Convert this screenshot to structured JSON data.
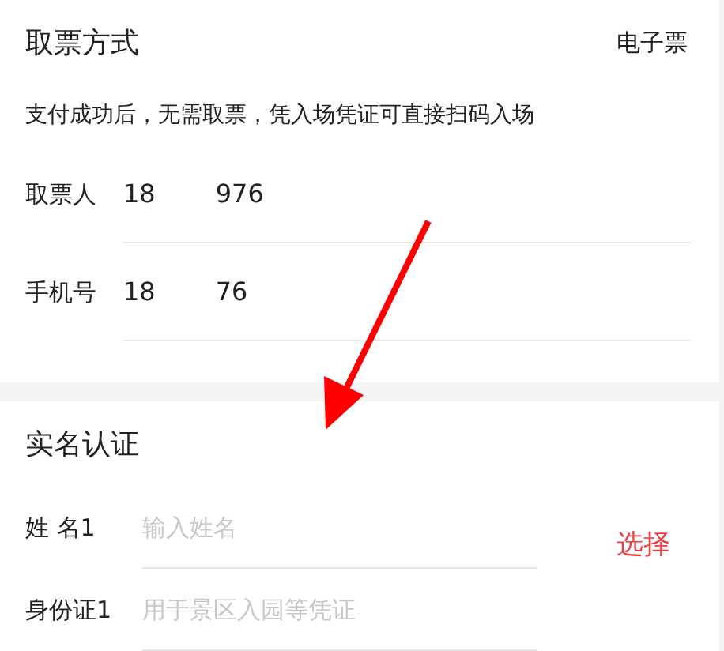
{
  "ticket_method": {
    "title": "取票方式",
    "value": "电子票",
    "note": "支付成功后，无需取票，凭入场凭证可直接扫码入场",
    "rows": [
      {
        "label": "取票人",
        "value_start": "18",
        "value_end": "976"
      },
      {
        "label": "手机号",
        "value_start": "18",
        "value_end": "76"
      }
    ]
  },
  "real_name": {
    "title": "实名认证",
    "action": "选择",
    "fields": [
      {
        "label": "姓 名1",
        "placeholder": "输入姓名"
      },
      {
        "label": "身份证1",
        "placeholder": "用于景区入园等凭证"
      }
    ]
  },
  "annotation": {
    "kind": "arrow"
  }
}
